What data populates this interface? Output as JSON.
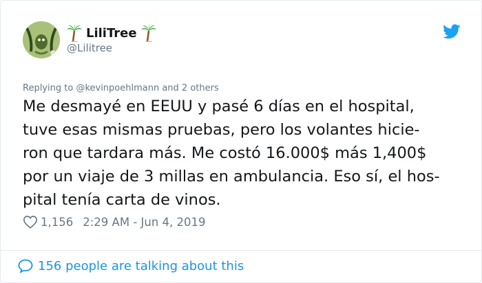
{
  "user": {
    "display_name": "LiliTree",
    "handle": "@Lilitree",
    "avatar_icon": "avatar-illustration",
    "name_emoji": "palm-tree-icon",
    "verified_brand_icon": "twitter-bird-icon"
  },
  "tweet": {
    "reply_prefix": "Replying to",
    "reply_target": "@kevinpoehlmann and 2 others",
    "text_lines": [
      "Me desmayé en EEUU y pasé 6 días en el hospital,",
      "tuve esas mismas pruebas, pero los volantes hicie-",
      "ron que tardara más. Me costó 16.000$ más 1,400$",
      "por un viaje de 3 millas en ambulancia. Eso sí, el hos-",
      "pital tenía carta de vinos."
    ],
    "likes": "1,156",
    "timestamp": "2:29 AM - Jun 4, 2019"
  },
  "footer": {
    "talking_text": "156 people are talking about this"
  },
  "colors": {
    "text": "#14171a",
    "muted": "#657786",
    "link": "#1b95e0",
    "border": "#e6ecf0"
  }
}
